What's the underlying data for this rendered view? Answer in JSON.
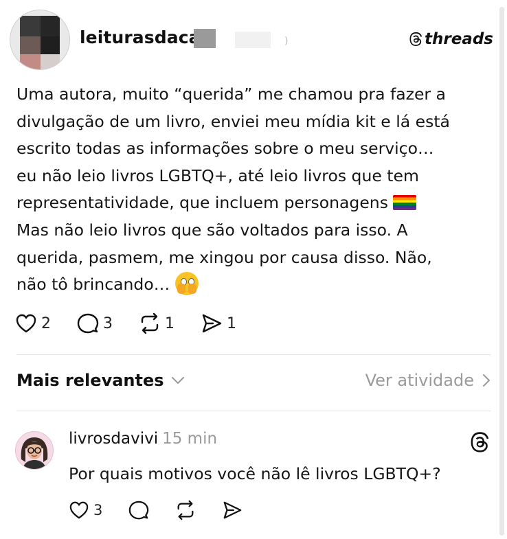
{
  "post": {
    "username": "leiturasdaca",
    "brand": "threads",
    "lines": [
      "Uma autora, muito “querida” me chamou pra fazer a",
      "divulgação de um livro, enviei meu mídia kit e lá está",
      "escrito todas as informações sobre o meu serviço…",
      "eu não leio livros LGBTQ+, até leio livros que tem",
      "representatividade, que incluem personagens",
      "Mas não leio livros que são voltados para isso. A",
      "querida, pasmem, me xingou por causa disso. Não,",
      "não tô brincando…"
    ],
    "emoji_rainbow": "rainbow-flag",
    "emoji_face": "face-with-open-eyes-and-hand-over-mouth",
    "likes": "2",
    "replies": "3",
    "reposts": "1",
    "shares": "1"
  },
  "sort": {
    "label": "Mais relevantes",
    "activity": "Ver atividade"
  },
  "reply": {
    "username": "livrosdavivi",
    "time": "15 min",
    "text": "Por quais motivos você não lê livros LGBTQ+?",
    "likes": "3"
  },
  "colors": {
    "text": "#111111",
    "muted": "#9a9a9a",
    "divider": "#e3e3e3"
  }
}
